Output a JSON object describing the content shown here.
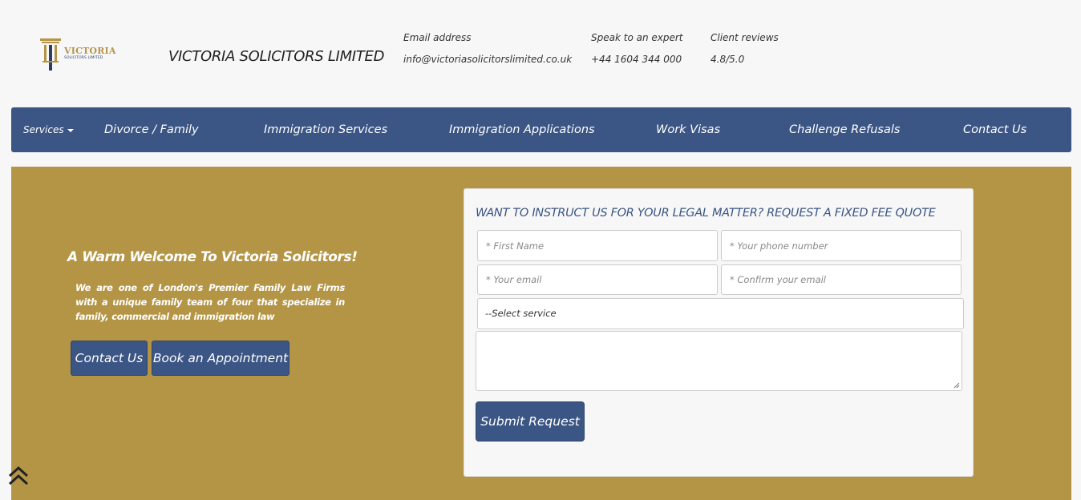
{
  "brand": {
    "logo_text": "VICTORIA",
    "logo_subtext": "SOLICITORS LIMITED",
    "company_name": "VICTORIA SOLICITORS LIMITED",
    "accent_color": "#b49545",
    "primary_color": "#3b5584"
  },
  "contact_info": {
    "email_label": "Email address",
    "email_value": "info@victoriasolicitorslimited.co.uk",
    "phone_label": "Speak to an expert",
    "phone_value": "+44 1604 344 000",
    "reviews_label": "Client reviews",
    "reviews_value": "4.8/5.0"
  },
  "nav": {
    "items": [
      {
        "label": "Services"
      },
      {
        "label": "Divorce / Family"
      },
      {
        "label": "Immigration Services"
      },
      {
        "label": "Immigration Applications"
      },
      {
        "label": "Work Visas"
      },
      {
        "label": "Challenge Refusals"
      },
      {
        "label": "Contact Us"
      }
    ]
  },
  "hero": {
    "welcome": "A Warm Welcome To Victoria Solicitors!",
    "intro": "We are one of London's Premier Family Law Firms with a unique family team of four that specialize in family, commercial and immigration law",
    "contact_button": "Contact Us",
    "book_button": "Book an Appointment"
  },
  "quote_form": {
    "title": "WANT TO INSTRUCT US FOR YOUR LEGAL MATTER? REQUEST A FIXED FEE QUOTE",
    "first_name_placeholder": "* First Name",
    "phone_placeholder": "* Your phone number",
    "email_placeholder": "* Your email",
    "confirm_email_placeholder": "* Confirm your email",
    "service_selected": "--Select service",
    "message_value": "",
    "submit_label": "Submit Request"
  },
  "icons": {
    "back_to_top": "double-chevron-up-icon",
    "services_caret": "caret-down-icon"
  }
}
